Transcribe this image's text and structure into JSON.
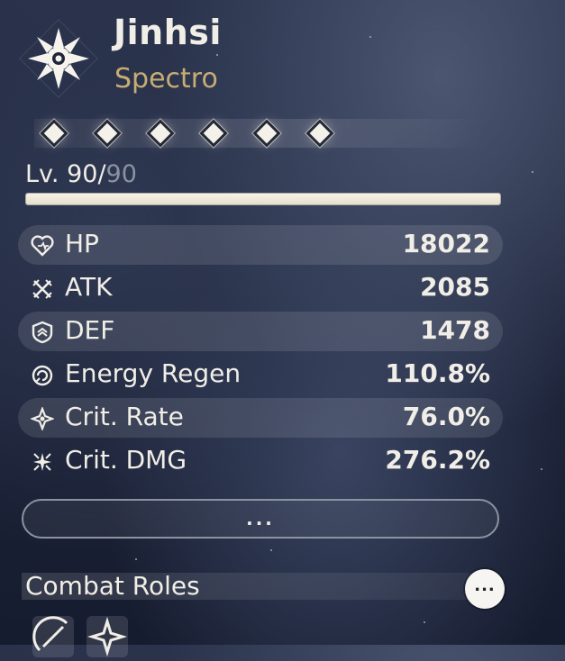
{
  "character": {
    "name": "Jinhsi",
    "element": "Spectro",
    "element_color": "#c7ac74",
    "level_label": "Lv. 90/",
    "level_max": "90",
    "level_progress": 1.0,
    "resonance_chain_nodes": 6
  },
  "stats": [
    {
      "label": "HP",
      "value": "18022",
      "icon": "hp-heart-icon"
    },
    {
      "label": "ATK",
      "value": "2085",
      "icon": "atk-swords-icon"
    },
    {
      "label": "DEF",
      "value": "1478",
      "icon": "def-shield-icon"
    },
    {
      "label": "Energy Regen",
      "value": "110.8%",
      "icon": "energy-regen-icon"
    },
    {
      "label": "Crit. Rate",
      "value": "76.0%",
      "icon": "crit-rate-icon"
    },
    {
      "label": "Crit. DMG",
      "value": "276.2%",
      "icon": "crit-dmg-icon"
    }
  ],
  "more_button": "...",
  "combat_roles": {
    "title": "Combat Roles",
    "info_button": "...",
    "roles": [
      "role-sword-icon",
      "role-star-icon"
    ]
  }
}
